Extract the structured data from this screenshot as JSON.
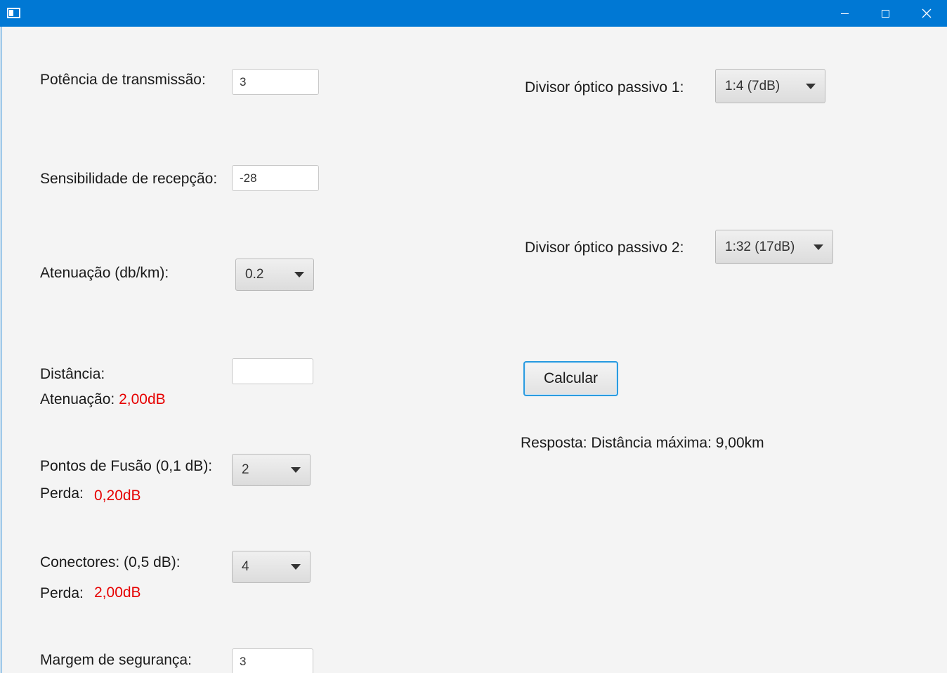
{
  "window": {
    "title": ""
  },
  "form": {
    "potencia": {
      "label": "Potência de transmissão:",
      "value": "3"
    },
    "sensibilidade": {
      "label": "Sensibilidade de recepção:",
      "value": "-28"
    },
    "atenuacao_km": {
      "label": "Atenuação (db/km):",
      "selected": "0.2"
    },
    "distancia": {
      "label": "Distância:",
      "value": ""
    },
    "atenuacao_result": {
      "label": "Atenuação:",
      "value": "2,00dB"
    },
    "fusao": {
      "label": "Pontos de Fusão (0,1 dB):",
      "selected": "2",
      "perda_label": "Perda:",
      "perda_value": "0,20dB"
    },
    "conectores": {
      "label": "Conectores: (0,5 dB):",
      "selected": "4",
      "perda_label": "Perda:",
      "perda_value": "2,00dB"
    },
    "margem": {
      "label": "Margem de segurança:",
      "value": "3"
    },
    "divisor1": {
      "label": "Divisor óptico passivo 1:",
      "selected": "1:4 (7dB)"
    },
    "divisor2": {
      "label": "Divisor óptico passivo 2:",
      "selected": "1:32 (17dB)"
    },
    "calcular_label": "Calcular",
    "resposta": "Resposta: Distância máxima: 9,00km"
  },
  "colors": {
    "titlebar": "#0078d4",
    "result_red": "#e60000",
    "button_focus": "#2b9be0"
  }
}
